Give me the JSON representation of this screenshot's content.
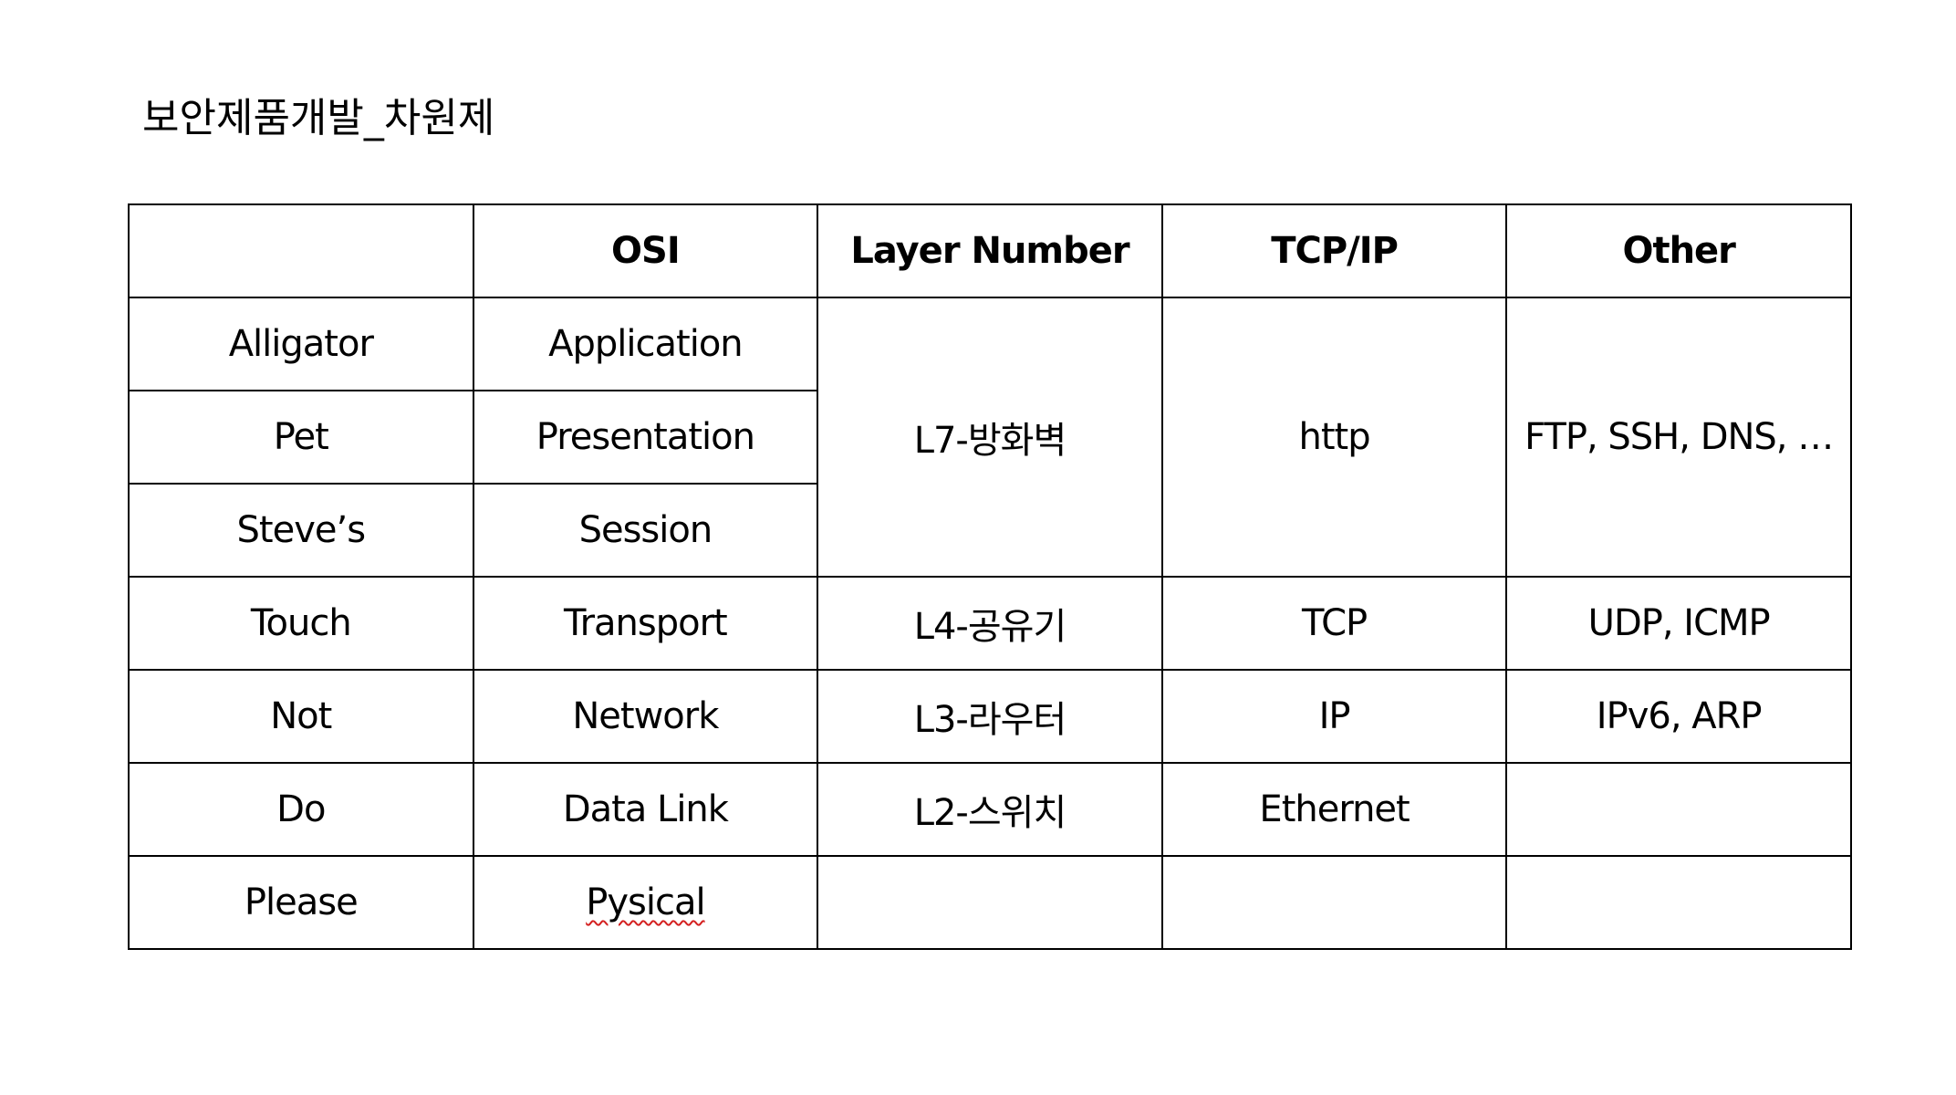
{
  "title": "보안제품개발_차원제",
  "table": {
    "headers": [
      "",
      "OSI",
      "Layer Number",
      "TCP/IP",
      "Other"
    ],
    "mnemonic": [
      "Alligator",
      "Pet",
      "Steve’s",
      "Touch",
      "Not",
      "Do",
      "Please"
    ],
    "osi": [
      "Application",
      "Presentation",
      "Session",
      "Transport",
      "Network",
      "Data Link",
      "Pysical"
    ],
    "layer_number": {
      "upper": "L7-방화벽",
      "transport": "L4-공유기",
      "network": "L3-라우터",
      "data_link": "L2-스위치",
      "physical": ""
    },
    "tcp_ip": {
      "upper": "http",
      "transport": "TCP",
      "network": "IP",
      "data_link": "Ethernet",
      "physical": ""
    },
    "other": {
      "upper": "FTP, SSH, DNS, …",
      "transport": "UDP, ICMP",
      "network": "IPv6, ARP",
      "data_link": "",
      "physical": ""
    }
  }
}
